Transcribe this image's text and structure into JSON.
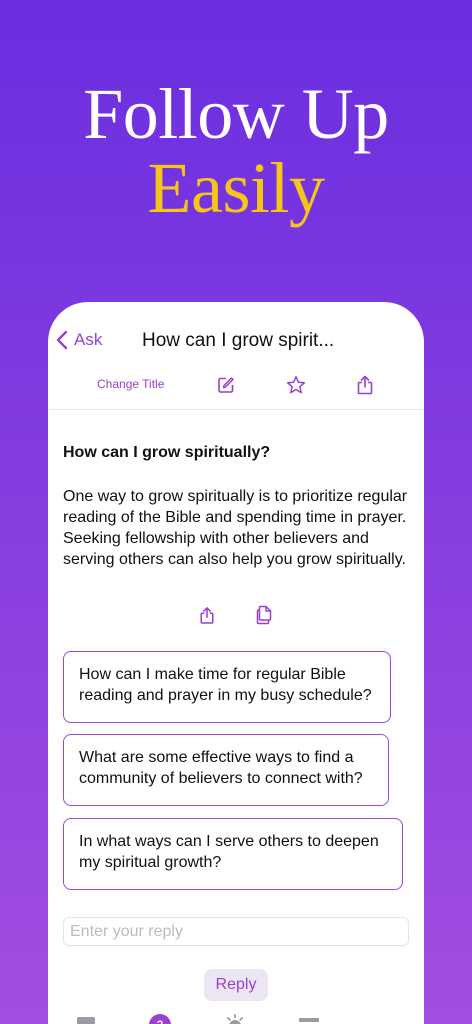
{
  "headline": {
    "line1": "Follow Up",
    "line2": "Easily"
  },
  "nav": {
    "back_label": "Ask",
    "title": "How can I grow spirit..."
  },
  "toolbar": {
    "change_title_label": "Change Title"
  },
  "conversation": {
    "question": "How can I grow spiritually?",
    "answer": "One way to grow spiritually is to prioritize regular reading of the Bible and spending time in prayer. Seeking fellowship with other believers and serving others can also help you grow spiritually."
  },
  "suggestions": [
    "How can I make time for regular Bible reading and prayer in my busy schedule?",
    "What are some effective ways to find a community of believers to connect with?",
    "In what ways can I serve others to deepen my spiritual growth?"
  ],
  "reply": {
    "placeholder": "Enter your reply",
    "button_label": "Reply"
  },
  "icons": [
    "chevron-left-icon",
    "edit-icon",
    "star-icon",
    "share-icon",
    "copy-icon",
    "book-icon",
    "ask-icon",
    "lightbulb-icon",
    "list-icon"
  ],
  "colors": {
    "accent": "#9b3fd0",
    "headline_yellow": "#f5c518",
    "background_top": "#6a2ee0",
    "background_bottom": "#a24ee0"
  }
}
